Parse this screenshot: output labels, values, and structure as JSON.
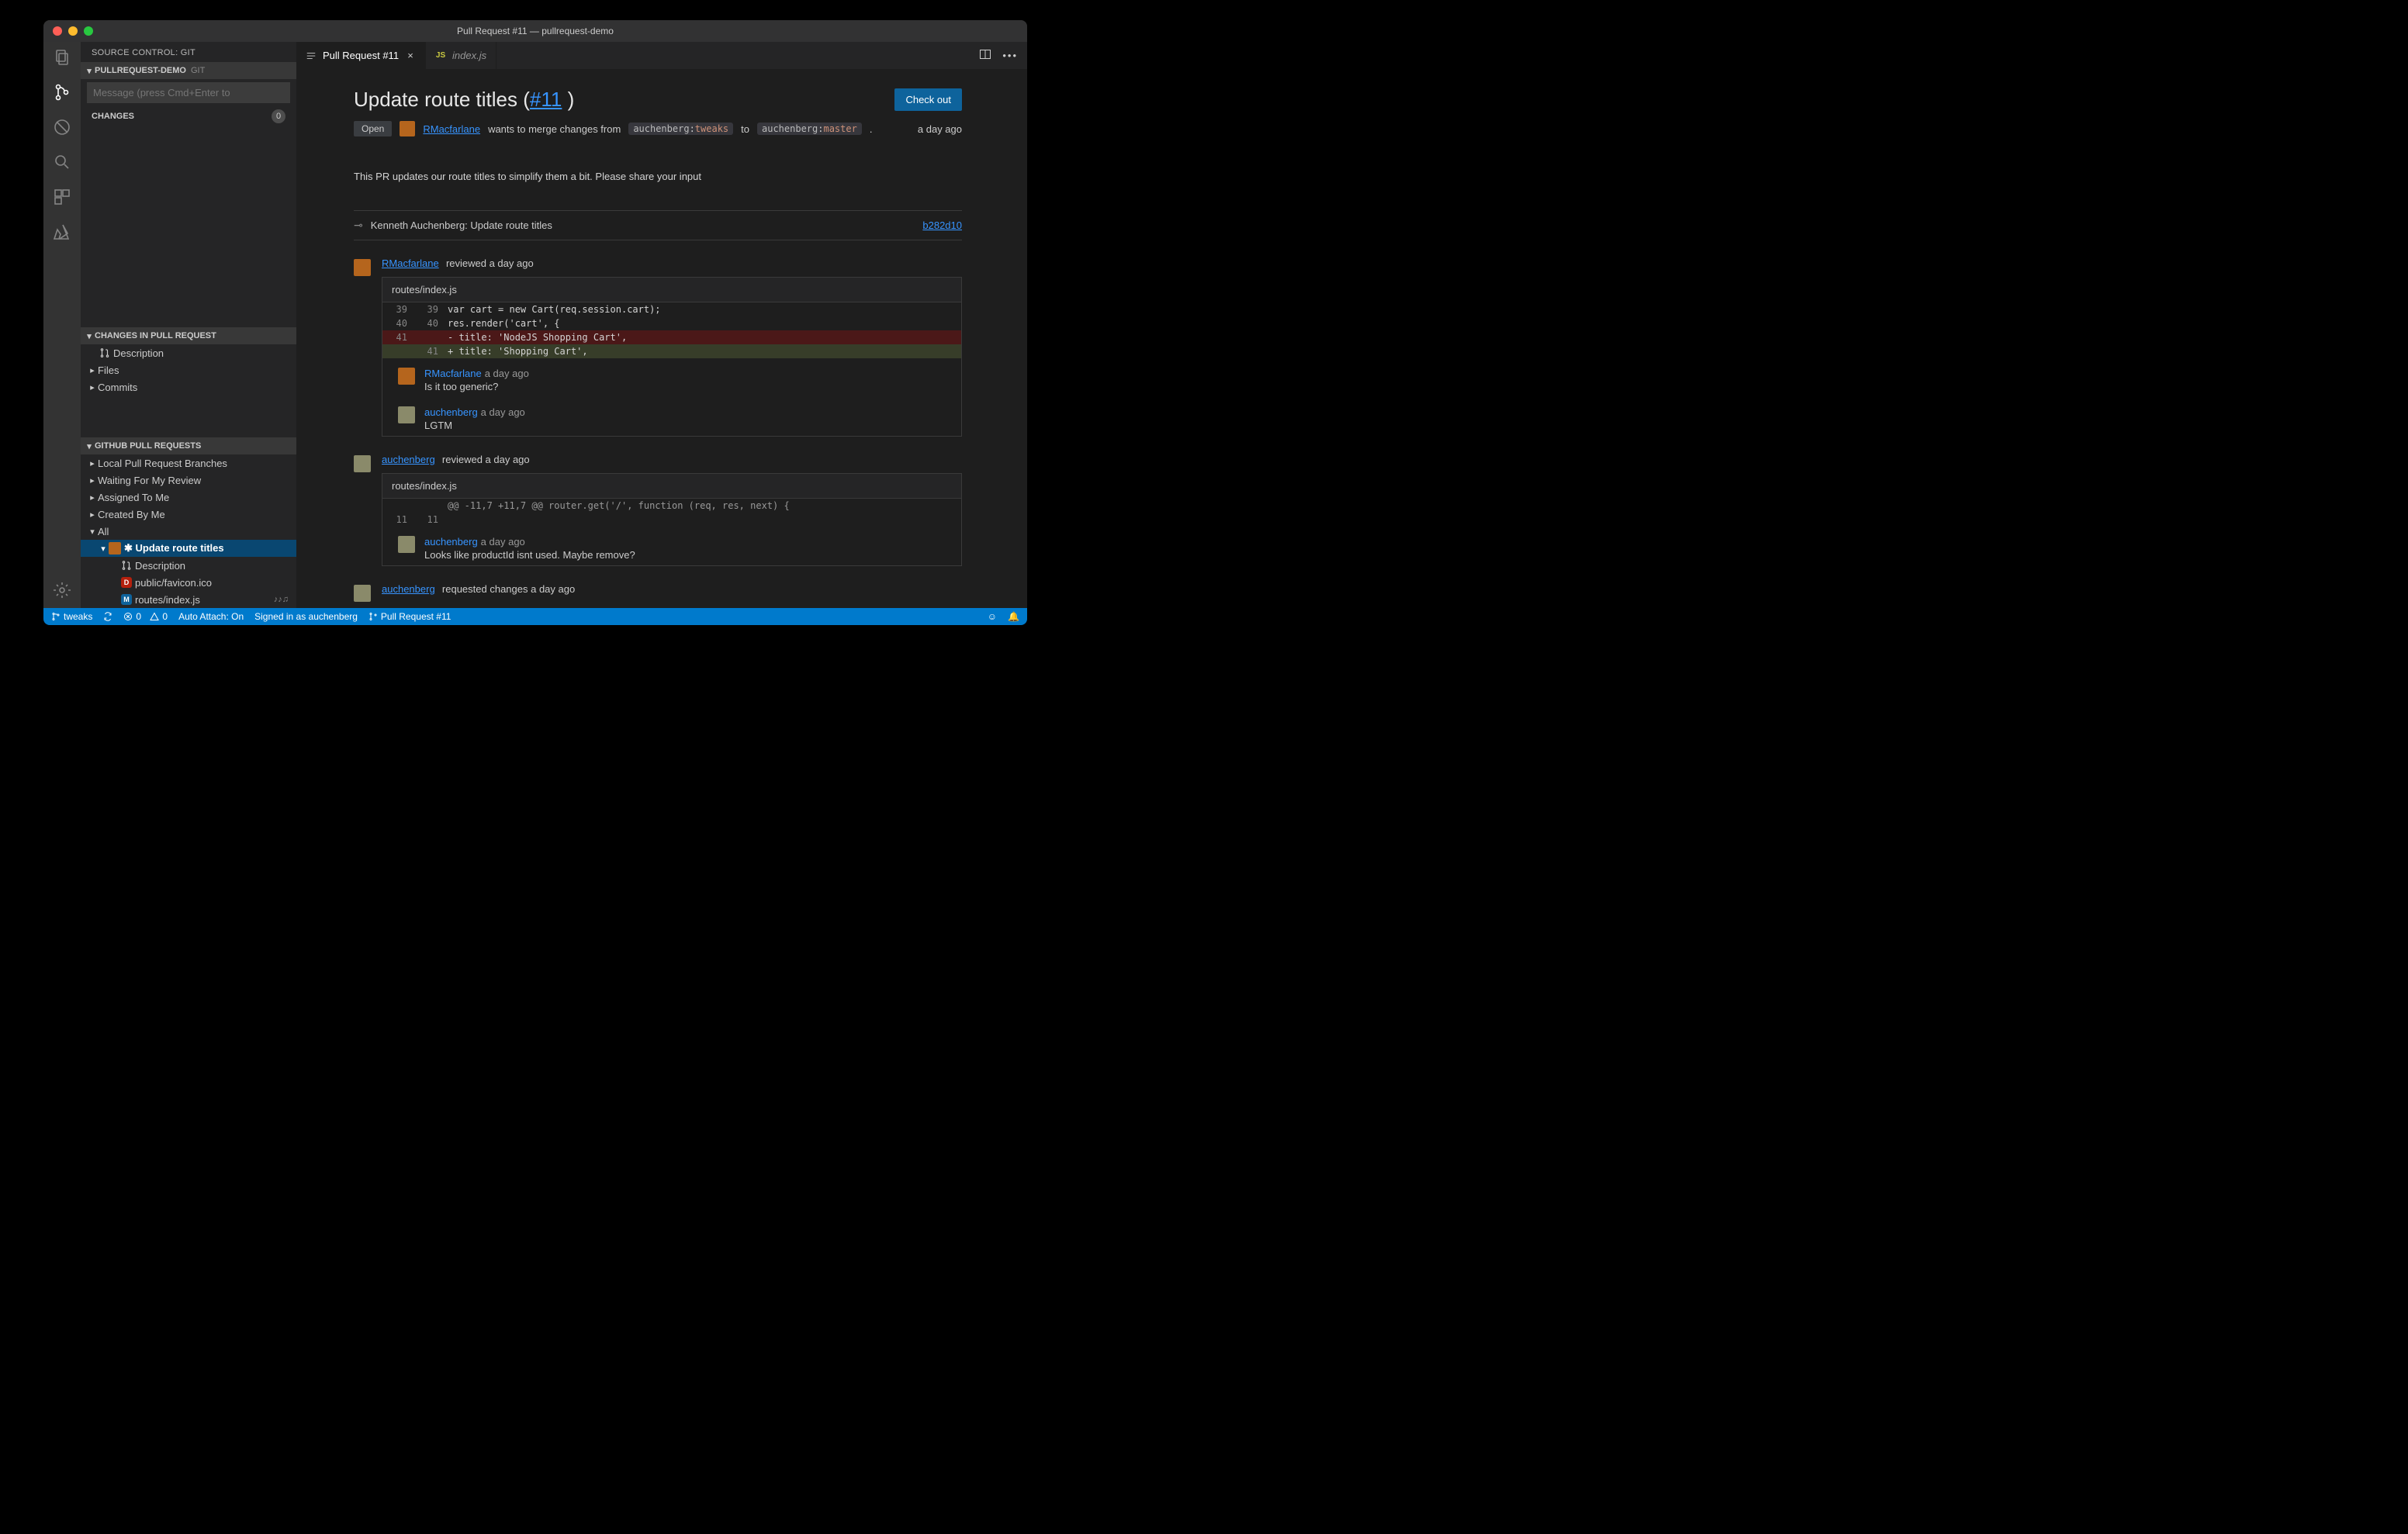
{
  "window_title": "Pull Request #11 — pullrequest-demo",
  "activity": {
    "items": [
      "files",
      "scm",
      "debug",
      "search",
      "extensions",
      "azure"
    ],
    "bottom": [
      "settings"
    ]
  },
  "sidebar": {
    "title": "SOURCE CONTROL: GIT",
    "repo_header": {
      "name": "PULLREQUEST-DEMO",
      "provider": "GIT"
    },
    "commit_placeholder": "Message (press Cmd+Enter to",
    "changes_label": "CHANGES",
    "changes_count": "0",
    "pr_section_header": "CHANGES IN PULL REQUEST",
    "pr_section_items": [
      {
        "label": "Description",
        "icon": "pr",
        "chev": ""
      },
      {
        "label": "Files",
        "icon": "",
        "chev": "▸"
      },
      {
        "label": "Commits",
        "icon": "",
        "chev": "▸"
      }
    ],
    "gh_section_header": "GITHUB PULL REQUESTS",
    "gh_items": [
      {
        "label": "Local Pull Request Branches",
        "chev": "▸",
        "indent": 0
      },
      {
        "label": "Waiting For My Review",
        "chev": "▸",
        "indent": 0
      },
      {
        "label": "Assigned To Me",
        "chev": "▸",
        "indent": 0
      },
      {
        "label": "Created By Me",
        "chev": "▸",
        "indent": 0
      },
      {
        "label": "All",
        "chev": "▾",
        "indent": 0
      },
      {
        "label": "✱ Update route titles",
        "chev": "▾",
        "indent": 1,
        "avatar": true,
        "selected": true
      },
      {
        "label": "Description",
        "chev": "",
        "indent": 2,
        "icon": "pr"
      },
      {
        "label": "public/favicon.ico",
        "chev": "",
        "indent": 2,
        "letter": "D"
      },
      {
        "label": "routes/index.js",
        "chev": "",
        "indent": 2,
        "letter": "M",
        "trailing": "♪♪♫"
      }
    ]
  },
  "tabs": [
    {
      "label": "Pull Request #11",
      "icon": "pr-list",
      "active": true,
      "closeable": true
    },
    {
      "label": "index.js",
      "icon": "js",
      "active": false,
      "closeable": false
    }
  ],
  "pr": {
    "title_prefix": "Update route titles (",
    "title_link": "#11",
    "title_suffix": " )",
    "checkout_label": "Check out",
    "state": "Open",
    "author": "RMacfarlane",
    "merge_text_1": " wants to merge changes from ",
    "from_user": "auchenberg",
    "from_branch": "tweaks",
    "merge_text_2": " to ",
    "to_user": "auchenberg",
    "to_branch": "master",
    "merge_text_3": ".",
    "time": "a day ago",
    "description": "This PR updates our route titles to simplify them a bit. Please share your input",
    "commit_author": "Kenneth Auchenberg: Update route titles",
    "commit_sha": "b282d10",
    "reviews": [
      {
        "user": "RMacfarlane",
        "action": "reviewed a day ago",
        "avatar_color": "#b5651d",
        "file": "routes/index.js",
        "diff": [
          {
            "old": "39",
            "new": "39",
            "kind": "ctx",
            "code": "var cart = new Cart(req.session.cart);"
          },
          {
            "old": "40",
            "new": "40",
            "kind": "ctx",
            "code": "res.render('cart', {"
          },
          {
            "old": "41",
            "new": "",
            "kind": "del",
            "code": "- title: 'NodeJS Shopping Cart',"
          },
          {
            "old": "",
            "new": "41",
            "kind": "add",
            "code": "+ title: 'Shopping Cart',"
          }
        ],
        "comments": [
          {
            "user": "RMacfarlane",
            "time": "a day ago",
            "body": "Is it too generic?",
            "avatar_color": "#b5651d"
          },
          {
            "user": "auchenberg",
            "time": "a day ago",
            "body": "LGTM",
            "avatar_color": "#8a8a6a"
          }
        ]
      },
      {
        "user": "auchenberg",
        "action": "reviewed a day ago",
        "avatar_color": "#8a8a6a",
        "file": "routes/index.js",
        "diff": [
          {
            "old": "",
            "new": "",
            "kind": "hunk",
            "code": "@@ -11,7 +11,7 @@ router.get('/', function (req, res, next) {"
          },
          {
            "old": "11",
            "new": "11",
            "kind": "ctx",
            "code": ""
          }
        ],
        "comments": [
          {
            "user": "auchenberg",
            "time": "a day ago",
            "body": "Looks like productId isnt used. Maybe remove?",
            "avatar_color": "#8a8a6a"
          }
        ]
      }
    ],
    "final": {
      "user": "auchenberg",
      "action": "requested changes a day ago",
      "avatar_color": "#8a8a6a"
    }
  },
  "statusbar": {
    "branch": "tweaks",
    "errors": "0",
    "warnings": "0",
    "auto_attach": "Auto Attach: On",
    "signed_in": "Signed in as auchenberg",
    "pr": "Pull Request #11"
  }
}
